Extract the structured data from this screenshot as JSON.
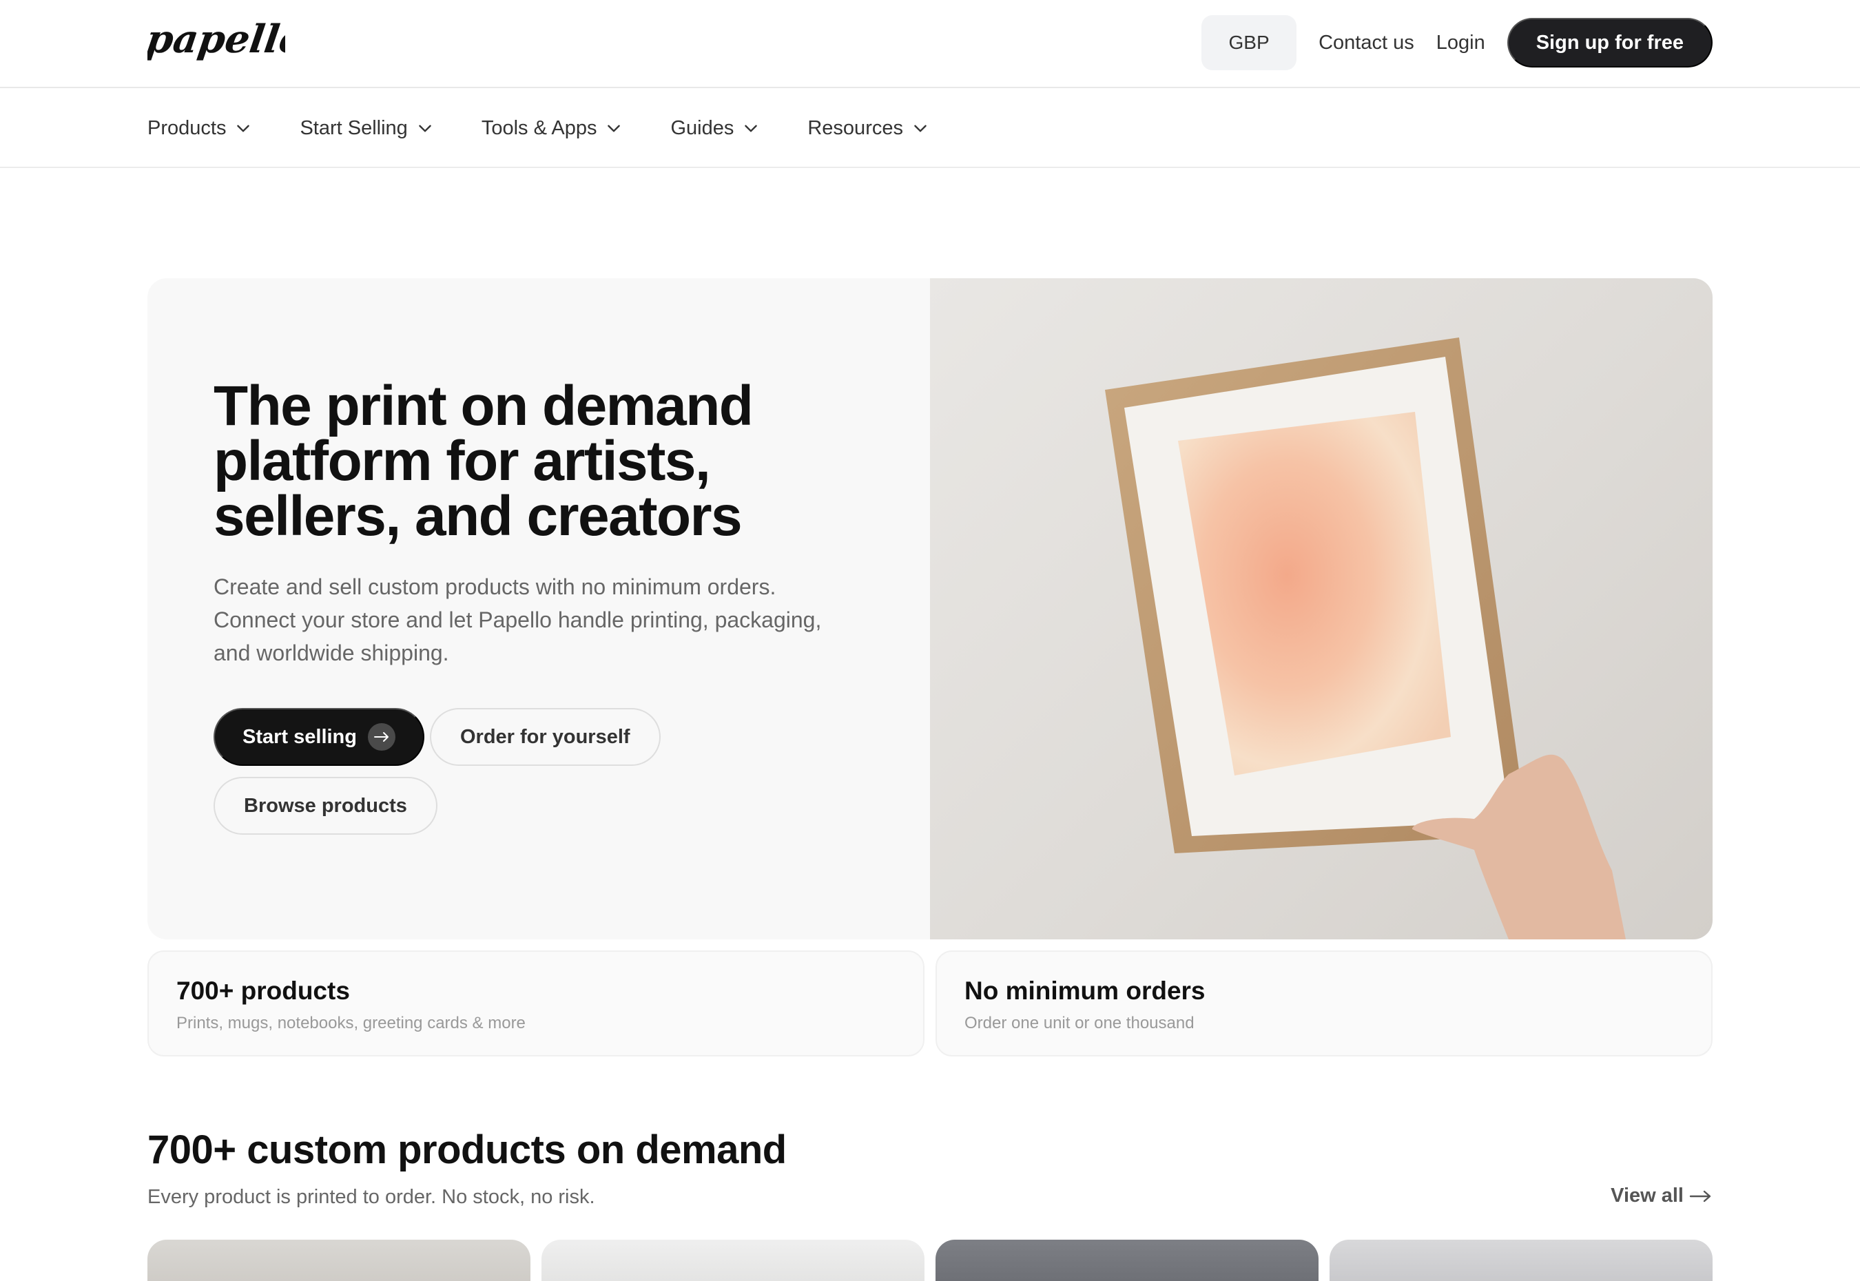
{
  "header": {
    "logo_text": "papello",
    "currency": "GBP",
    "contact_label": "Contact us",
    "login_label": "Login",
    "signup_label": "Sign up for free"
  },
  "nav": {
    "items": [
      {
        "label": "Products"
      },
      {
        "label": "Start Selling"
      },
      {
        "label": "Tools & Apps"
      },
      {
        "label": "Guides"
      },
      {
        "label": "Resources"
      }
    ]
  },
  "hero": {
    "title": "The print on demand platform for artists, sellers, and creators",
    "subtitle": "Create and sell custom products with no minimum orders. Connect your store and let Papello handle printing, packaging, and worldwide shipping.",
    "primary_label": "Start selling",
    "order_label": "Order for yourself",
    "browse_label": "Browse products"
  },
  "features": [
    {
      "title": "700+ products",
      "subtitle": "Prints, mugs, notebooks, greeting cards & more"
    },
    {
      "title": "No minimum orders",
      "subtitle": "Order one unit or one thousand"
    }
  ],
  "products_section": {
    "title": "700+ custom products on demand",
    "subtitle": "Every product is printed to order. No stock, no risk.",
    "view_all_label": "View all"
  },
  "colors": {
    "primary_button": "#141414",
    "signup_button": "#1f1f22",
    "hero_bg": "#f8f8f8",
    "text_muted": "#666666"
  }
}
